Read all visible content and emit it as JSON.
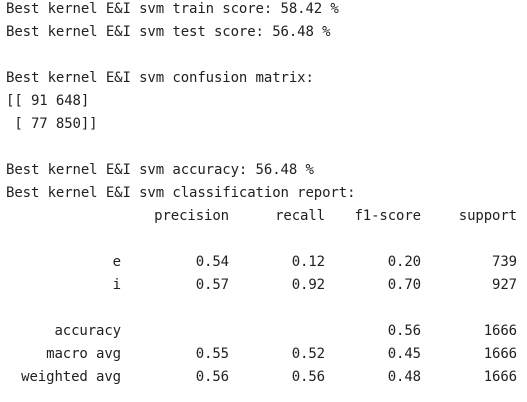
{
  "lines": {
    "train_score": "Best kernel E&I svm train score: 58.42 %",
    "test_score": "Best kernel E&I svm test score: 56.48 %",
    "cm_title": "Best kernel E&I svm confusion matrix:",
    "cm_row1": "[[ 91 648]",
    "cm_row2": " [ 77 850]]",
    "accuracy": "Best kernel E&I svm accuracy: 56.48 %",
    "report_title": "Best kernel E&I svm classification report:"
  },
  "report": {
    "headers": [
      "precision",
      "recall",
      "f1-score",
      "support"
    ],
    "rows": [
      {
        "label": "e",
        "precision": "0.54",
        "recall": "0.12",
        "f1": "0.20",
        "support": "739"
      },
      {
        "label": "i",
        "precision": "0.57",
        "recall": "0.92",
        "f1": "0.70",
        "support": "927"
      },
      {
        "label": "accuracy",
        "precision": "",
        "recall": "",
        "f1": "0.56",
        "support": "1666"
      },
      {
        "label": "macro avg",
        "precision": "0.55",
        "recall": "0.52",
        "f1": "0.45",
        "support": "1666"
      },
      {
        "label": "weighted avg",
        "precision": "0.56",
        "recall": "0.56",
        "f1": "0.48",
        "support": "1666"
      }
    ]
  }
}
